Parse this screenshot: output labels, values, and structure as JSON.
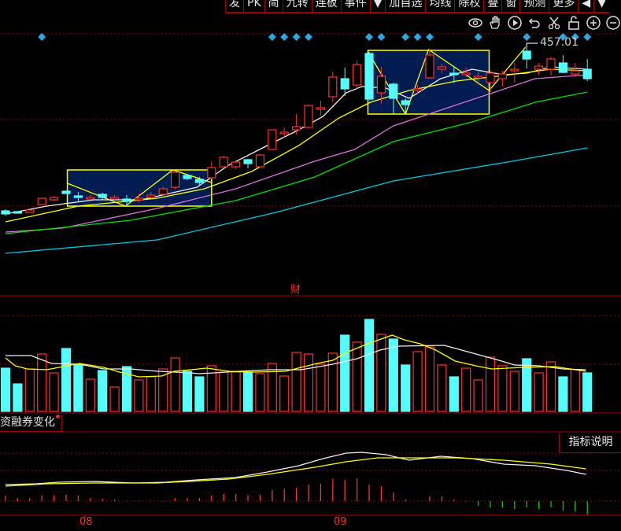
{
  "toolbar": {
    "items": [
      "发",
      "PK",
      "简",
      "九转",
      "连板",
      "事件",
      "▼",
      "加自选",
      "均线",
      "除权",
      "叠",
      "窗",
      "预测",
      "更多",
      "◀",
      "▼"
    ]
  },
  "tools": [
    "eye-icon",
    "hand-icon",
    "play-icon",
    "undo-icon",
    "scissors-icon",
    "lock-icon",
    "zoom-in-icon",
    "zoom-out-icon"
  ],
  "main_panel": {
    "high_price_label": "457.01",
    "middle_tag": "财"
  },
  "indicator": {
    "title": "资融券变化",
    "help_button": "指标说明"
  },
  "x_axis": {
    "labels": [
      "08",
      "09"
    ],
    "label_index": [
      6.5,
      27.5
    ]
  },
  "colors": {
    "up": "#ff3030",
    "down": "#54fcfc",
    "grid": "#a00000",
    "box_fill": "#001c50",
    "box_border": "#ffff00"
  },
  "chart_data": {
    "type": "candlestick",
    "candles": [
      [
        244,
        246,
        238,
        240
      ],
      [
        243,
        243,
        241,
        241
      ],
      [
        242,
        245,
        242,
        245
      ],
      [
        252,
        260,
        252,
        260
      ],
      [
        258,
        263,
        256,
        261
      ],
      [
        269,
        269,
        266,
        266
      ],
      [
        263,
        268,
        255,
        261
      ],
      [
        259,
        264,
        256,
        261
      ],
      [
        265,
        267,
        258,
        261
      ],
      [
        259,
        264,
        257,
        261
      ],
      [
        259,
        264,
        250,
        256
      ],
      [
        258,
        266,
        254,
        260
      ],
      [
        261,
        268,
        260,
        264
      ],
      [
        265,
        275,
        264,
        272
      ],
      [
        274,
        295,
        271,
        293
      ],
      [
        289,
        290,
        283,
        285
      ],
      [
        284,
        287,
        277,
        280
      ],
      [
        286,
        307,
        284,
        299
      ],
      [
        300,
        314,
        299,
        312
      ],
      [
        300,
        308,
        297,
        306
      ],
      [
        309,
        310,
        298,
        304
      ],
      [
        300,
        316,
        299,
        315
      ],
      [
        322,
        347,
        322,
        347
      ],
      [
        342,
        350,
        337,
        344
      ],
      [
        347,
        367,
        341,
        351
      ],
      [
        350,
        379,
        349,
        378
      ],
      [
        373,
        384,
        365,
        375
      ],
      [
        389,
        421,
        382,
        414
      ],
      [
        412,
        426,
        390,
        399
      ],
      [
        404,
        435,
        399,
        430
      ],
      [
        444,
        446,
        386,
        386
      ],
      [
        394,
        427,
        380,
        415
      ],
      [
        405,
        407,
        366,
        387
      ],
      [
        384,
        387,
        367,
        379
      ],
      [
        397,
        404,
        392,
        399
      ],
      [
        413,
        449,
        412,
        442
      ],
      [
        424,
        431,
        419,
        427
      ],
      [
        419,
        428,
        407,
        417
      ],
      [
        417,
        426,
        414,
        419
      ],
      [
        413,
        424,
        404,
        415
      ],
      [
        407,
        423,
        395,
        419
      ],
      [
        412,
        422,
        402,
        418
      ],
      [
        422,
        432,
        407,
        424
      ],
      [
        447,
        452,
        425,
        437
      ],
      [
        424,
        432,
        417,
        428
      ],
      [
        424,
        440,
        416,
        437
      ],
      [
        432,
        442,
        419,
        420
      ],
      [
        418,
        432,
        414,
        422
      ],
      [
        424,
        437,
        409,
        412
      ]
    ],
    "candle_fields": [
      "open",
      "high",
      "low",
      "close"
    ],
    "ma_lines": [
      {
        "name": "MA5",
        "color": "#f0f0f0",
        "points": [
          [
            0,
            240
          ],
          [
            3.4,
            250
          ],
          [
            7.3,
            258
          ],
          [
            11.2,
            258
          ],
          [
            15.8,
            274
          ],
          [
            18.4,
            302
          ],
          [
            21.6,
            327
          ],
          [
            24.2,
            347
          ],
          [
            26.2,
            364
          ],
          [
            28.1,
            394
          ],
          [
            29.4,
            402
          ],
          [
            31.4,
            400
          ],
          [
            33.3,
            387
          ],
          [
            35.9,
            412
          ],
          [
            38.5,
            424
          ],
          [
            41.1,
            417
          ],
          [
            43,
            419
          ],
          [
            45,
            427
          ],
          [
            48,
            424
          ]
        ]
      },
      {
        "name": "MA10",
        "color": "#ffff00",
        "points": [
          [
            0,
            230
          ],
          [
            6,
            250
          ],
          [
            12.5,
            260
          ],
          [
            16.4,
            272
          ],
          [
            20.3,
            294
          ],
          [
            24.2,
            327
          ],
          [
            27.5,
            362
          ],
          [
            30.1,
            382
          ],
          [
            33.3,
            397
          ],
          [
            37.2,
            409
          ],
          [
            41.1,
            416
          ],
          [
            45,
            424
          ],
          [
            48,
            422
          ]
        ]
      },
      {
        "name": "MA20",
        "color": "#e070e0",
        "points": [
          [
            0,
            217
          ],
          [
            4.7,
            222
          ],
          [
            12.5,
            247
          ],
          [
            19,
            272
          ],
          [
            25.5,
            307
          ],
          [
            28.8,
            322
          ],
          [
            32,
            352
          ],
          [
            35.9,
            372
          ],
          [
            39.8,
            392
          ],
          [
            43.7,
            412
          ],
          [
            48,
            417
          ]
        ]
      },
      {
        "name": "MA30",
        "color": "#00e000",
        "points": [
          [
            0,
            215
          ],
          [
            10.3,
            232
          ],
          [
            19,
            257
          ],
          [
            25.5,
            287
          ],
          [
            32,
            332
          ],
          [
            35.9,
            347
          ],
          [
            38.5,
            357
          ],
          [
            43.7,
            382
          ],
          [
            48,
            395
          ]
        ]
      },
      {
        "name": "MA60",
        "color": "#00c8e8",
        "points": [
          [
            0,
            190
          ],
          [
            12.5,
            207
          ],
          [
            22.3,
            242
          ],
          [
            32,
            282
          ],
          [
            41.8,
            307
          ],
          [
            48,
            324
          ]
        ]
      }
    ],
    "boxes": [
      {
        "from": 5.1,
        "to": 17,
        "low": 250,
        "high": 296,
        "zigzag": [
          [
            5.1,
            279
          ],
          [
            9.9,
            250
          ],
          [
            13.8,
            296
          ],
          [
            17,
            280
          ]
        ]
      },
      {
        "from": 29.9,
        "to": 39.9,
        "low": 367,
        "high": 448,
        "zigzag": [
          [
            29.9,
            446
          ],
          [
            33,
            367
          ],
          [
            34.9,
            449
          ],
          [
            39.9,
            397
          ],
          [
            42.9,
            452
          ]
        ]
      }
    ],
    "signal_markers": [
      3,
      22,
      23,
      24,
      25,
      30,
      31,
      33,
      34,
      35,
      39,
      43,
      46,
      47,
      48
    ],
    "high_marker": {
      "index": 43,
      "price": 457.01
    },
    "volume": [
      55,
      35,
      54,
      73,
      49,
      80,
      60,
      41,
      52,
      31,
      57,
      40,
      44,
      54,
      68,
      51,
      44,
      58,
      50,
      50,
      50,
      48,
      61,
      45,
      75,
      73,
      60,
      74,
      97,
      88,
      117,
      98,
      92,
      59,
      76,
      82,
      59,
      44,
      55,
      40,
      69,
      58,
      51,
      67,
      49,
      63,
      44,
      53,
      49
    ],
    "volume_ma": [
      {
        "name": "VMA5",
        "color": "#f0f0f0",
        "points": [
          [
            0,
            71
          ],
          [
            2.1,
            71
          ],
          [
            3.8,
            61
          ],
          [
            6.1,
            60
          ],
          [
            8.1,
            54
          ],
          [
            10.3,
            54
          ],
          [
            12.6,
            51
          ],
          [
            15.3,
            49
          ],
          [
            15.9,
            48
          ],
          [
            17.2,
            49
          ],
          [
            19.2,
            51
          ],
          [
            21.8,
            53
          ],
          [
            24.4,
            53
          ],
          [
            27,
            60
          ],
          [
            29,
            67
          ],
          [
            30.9,
            78
          ],
          [
            32.5,
            83
          ],
          [
            36.2,
            84
          ],
          [
            38.1,
            76
          ],
          [
            40.7,
            65
          ],
          [
            42,
            59
          ],
          [
            44,
            58
          ],
          [
            46,
            54
          ],
          [
            47.9,
            53
          ]
        ]
      },
      {
        "name": "VMA10",
        "color": "#ffff00",
        "points": [
          [
            0,
            68
          ],
          [
            0.8,
            58
          ],
          [
            1.8,
            54
          ],
          [
            3.4,
            53
          ],
          [
            6.1,
            61
          ],
          [
            8.1,
            56
          ],
          [
            9.4,
            50
          ],
          [
            11,
            44
          ],
          [
            12.9,
            45
          ],
          [
            13.9,
            51
          ],
          [
            16.6,
            55
          ],
          [
            18.5,
            51
          ],
          [
            20.5,
            50
          ],
          [
            23.1,
            51
          ],
          [
            24.4,
            56
          ],
          [
            25.7,
            61
          ],
          [
            27,
            65
          ],
          [
            28.3,
            76
          ],
          [
            29.9,
            86
          ],
          [
            31.9,
            97
          ],
          [
            32.9,
            91
          ],
          [
            34.2,
            86
          ],
          [
            35.5,
            78
          ],
          [
            37.1,
            64
          ],
          [
            38.8,
            58
          ],
          [
            40.1,
            54
          ],
          [
            42.7,
            56
          ],
          [
            45.3,
            57
          ],
          [
            47.9,
            51
          ]
        ]
      }
    ],
    "margin_bars": [
      7,
      4,
      4,
      7,
      7,
      8,
      7,
      4,
      3,
      2,
      -0.5,
      -0.5,
      -0.5,
      -0.5,
      4,
      4,
      4,
      7,
      9,
      9,
      8,
      8,
      14,
      16,
      17,
      21,
      22,
      28,
      27,
      29,
      21,
      19,
      11,
      2,
      -0.5,
      6,
      6,
      2,
      -0.5,
      -6,
      -8,
      -8,
      -10,
      -8,
      -10,
      -8,
      -12,
      -13,
      -17
    ],
    "margin_lines": [
      {
        "name": "line1",
        "color": "#f0f0f0",
        "points": [
          [
            0,
            21
          ],
          [
            2.5,
            22
          ],
          [
            4.4,
            24
          ],
          [
            7.3,
            25
          ],
          [
            10.6,
            23
          ],
          [
            13.2,
            24
          ],
          [
            15.8,
            27
          ],
          [
            19,
            30
          ],
          [
            21.6,
            37
          ],
          [
            24.2,
            45
          ],
          [
            26.2,
            54
          ],
          [
            28.1,
            61
          ],
          [
            29.4,
            62
          ],
          [
            31.4,
            59
          ],
          [
            33.3,
            52
          ],
          [
            35.9,
            57
          ],
          [
            38.5,
            54
          ],
          [
            41.1,
            47
          ],
          [
            43.7,
            45
          ],
          [
            46.3,
            39
          ],
          [
            47.9,
            34
          ]
        ]
      },
      {
        "name": "line2",
        "color": "#ffff00",
        "points": [
          [
            0,
            19
          ],
          [
            3.4,
            22
          ],
          [
            7.3,
            23
          ],
          [
            12.5,
            23
          ],
          [
            15.1,
            25
          ],
          [
            18.4,
            28
          ],
          [
            21.6,
            34
          ],
          [
            25.5,
            43
          ],
          [
            28.1,
            50
          ],
          [
            30.7,
            55
          ],
          [
            33.3,
            55
          ],
          [
            37.2,
            55
          ],
          [
            41.1,
            52
          ],
          [
            45,
            47
          ],
          [
            47.9,
            41
          ]
        ]
      }
    ]
  }
}
